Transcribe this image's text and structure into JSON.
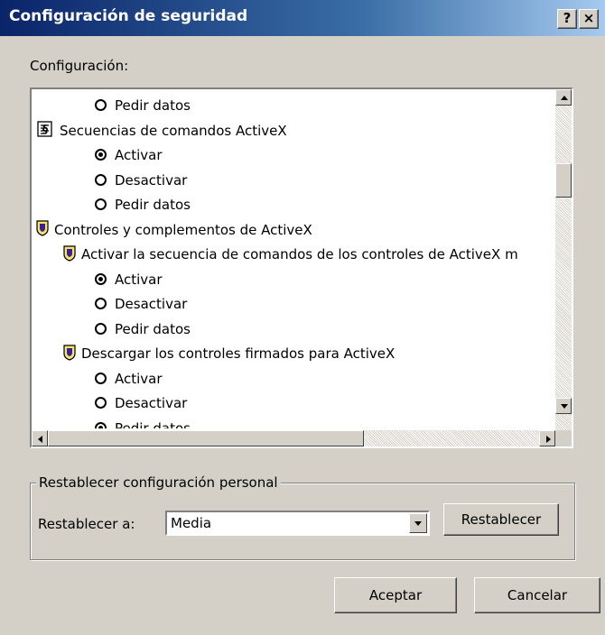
{
  "window": {
    "title": "Configuración de seguridad",
    "help_button": "?",
    "close_button": "×"
  },
  "settings_label": "Configuración:",
  "tree": [
    {
      "type": "radio",
      "label": "Pedir datos",
      "checked": false
    },
    {
      "type": "category",
      "icon": "script-icon",
      "label": "Secuencias de comandos ActiveX"
    },
    {
      "type": "radio",
      "label": "Activar",
      "checked": true
    },
    {
      "type": "radio",
      "label": "Desactivar",
      "checked": false
    },
    {
      "type": "radio",
      "label": "Pedir datos",
      "checked": false
    },
    {
      "type": "category",
      "icon": "shield-icon",
      "label": "Controles y complementos de ActiveX"
    },
    {
      "type": "subcategory",
      "icon": "shield-icon",
      "label": "Activar la secuencia de comandos de los controles de ActiveX m"
    },
    {
      "type": "radio",
      "label": "Activar",
      "checked": true
    },
    {
      "type": "radio",
      "label": "Desactivar",
      "checked": false
    },
    {
      "type": "radio",
      "label": "Pedir datos",
      "checked": false
    },
    {
      "type": "subcategory",
      "icon": "shield-icon",
      "label": "Descargar los controles firmados para ActiveX"
    },
    {
      "type": "radio",
      "label": "Activar",
      "checked": false
    },
    {
      "type": "radio",
      "label": "Desactivar",
      "checked": false
    },
    {
      "type": "radio",
      "label": "Pedir datos",
      "checked": true
    }
  ],
  "reset_group": {
    "legend": "Restablecer configuración personal",
    "reset_to_label": "Restablecer a:",
    "level_value": "Media",
    "reset_button": "Restablecer"
  },
  "buttons": {
    "ok": "Aceptar",
    "cancel": "Cancelar"
  },
  "colors": {
    "title_start": "#0a246a",
    "title_end": "#a6caf0",
    "face": "#d4d0c8"
  }
}
